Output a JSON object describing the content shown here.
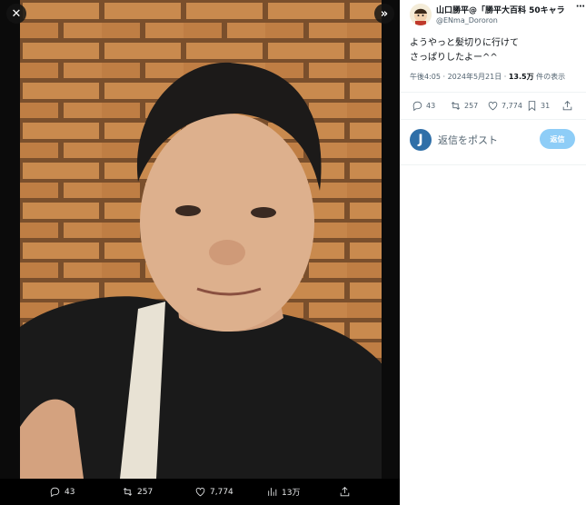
{
  "viewer": {
    "close_icon": "close-icon",
    "expand_icon": "chevron-double-right-icon",
    "actions": [
      {
        "name": "reply",
        "icon": "reply-icon",
        "count": "43"
      },
      {
        "name": "retweet",
        "icon": "retweet-icon",
        "count": "257"
      },
      {
        "name": "like",
        "icon": "heart-icon",
        "count": "7,774"
      },
      {
        "name": "views",
        "icon": "bar-chart-icon",
        "count": "13万"
      },
      {
        "name": "share",
        "icon": "share-icon",
        "count": ""
      }
    ]
  },
  "tweet": {
    "display_name": "山口勝平@「勝平大百科 50キャラ",
    "handle": "@ENma_Dororon",
    "more_icon": "more-icon",
    "text_line1": "ようやっと髪切りに行けて",
    "text_line2": "さっぱりしたよー^^",
    "timestamp": "午後4:05 · 2024年5月21日 · ",
    "views_count": "13.5万",
    "views_label": " 件の表示",
    "stats": {
      "replies": "43",
      "retweets": "257",
      "likes": "7,774",
      "bookmarks": "31"
    }
  },
  "reply": {
    "avatar_letter": "J",
    "placeholder": "返信をポスト",
    "button_label": "返信"
  },
  "colors": {
    "panel_bg": "#ffffff",
    "viewer_bg": "#000000",
    "reply_button": "#8ecdf7",
    "text_secondary": "#536471"
  }
}
